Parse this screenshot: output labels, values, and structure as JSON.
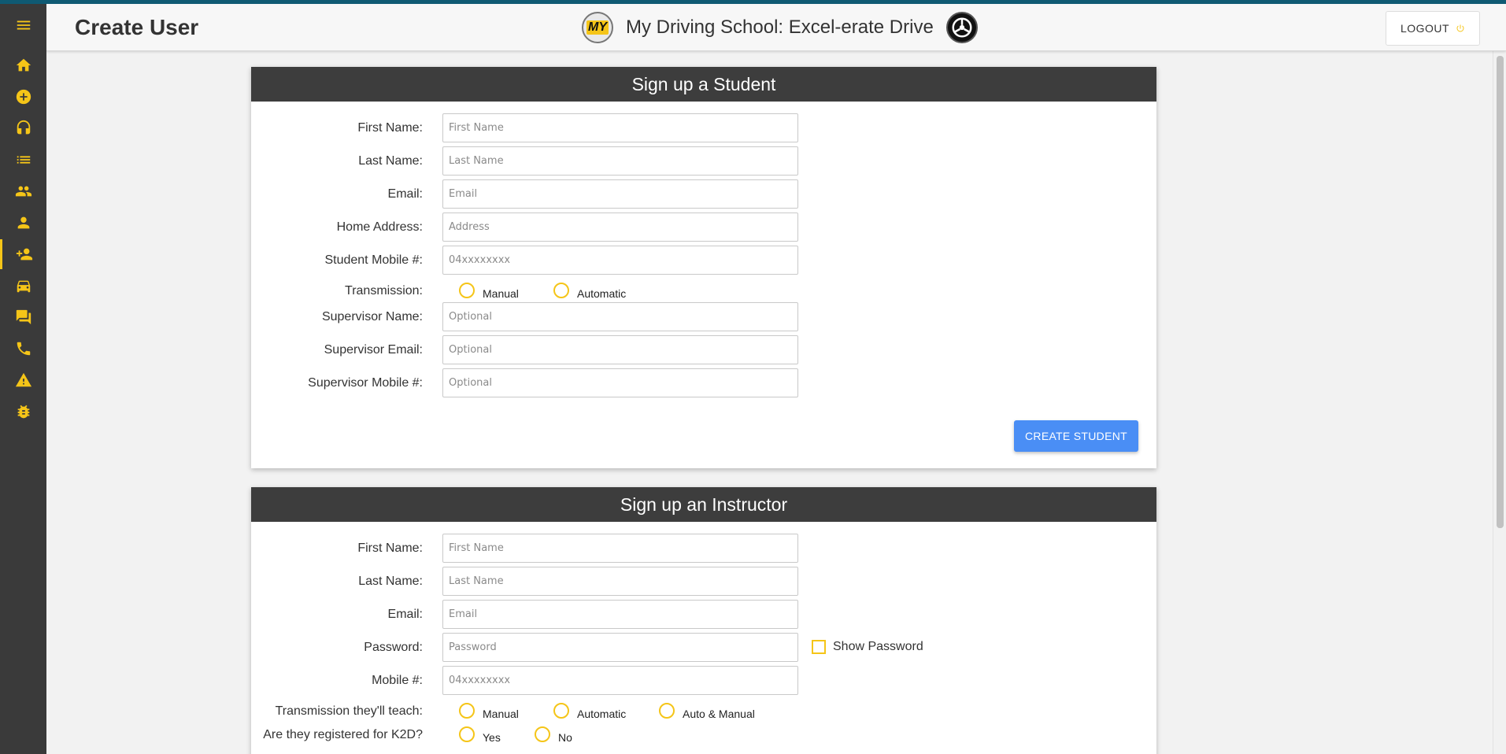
{
  "header": {
    "page_title": "Create User",
    "brand_name": "My Driving School: Excel-erate Drive",
    "logo_left_text": "MY",
    "logout_label": "LOGOUT"
  },
  "sidebar": {
    "items": [
      {
        "name": "home",
        "icon": "home-icon"
      },
      {
        "name": "add",
        "icon": "add-circle-icon"
      },
      {
        "name": "support",
        "icon": "headset-icon"
      },
      {
        "name": "list",
        "icon": "list-icon"
      },
      {
        "name": "users",
        "icon": "people-icon"
      },
      {
        "name": "user",
        "icon": "person-icon"
      },
      {
        "name": "create-user",
        "icon": "person-add-icon",
        "active": true
      },
      {
        "name": "cars",
        "icon": "car-icon"
      },
      {
        "name": "messages",
        "icon": "chat-icon"
      },
      {
        "name": "phone",
        "icon": "phone-icon"
      },
      {
        "name": "alerts",
        "icon": "warning-icon"
      },
      {
        "name": "bugs",
        "icon": "bug-icon"
      }
    ],
    "accent_color": "#f5c518"
  },
  "student": {
    "title": "Sign up a Student",
    "fields": {
      "first_name": {
        "label": "First Name:",
        "placeholder": "First Name",
        "value": ""
      },
      "last_name": {
        "label": "Last Name:",
        "placeholder": "Last Name",
        "value": ""
      },
      "email": {
        "label": "Email:",
        "placeholder": "Email",
        "value": ""
      },
      "address": {
        "label": "Home Address:",
        "placeholder": "Address",
        "value": ""
      },
      "mobile": {
        "label": "Student Mobile #:",
        "placeholder": "04xxxxxxxx",
        "value": ""
      },
      "supervisor_name": {
        "label": "Supervisor Name:",
        "placeholder": "Optional",
        "value": ""
      },
      "supervisor_email": {
        "label": "Supervisor Email:",
        "placeholder": "Optional",
        "value": ""
      },
      "supervisor_mobile": {
        "label": "Supervisor Mobile #:",
        "placeholder": "Optional",
        "value": ""
      }
    },
    "transmission": {
      "label": "Transmission:",
      "options": [
        "Manual",
        "Automatic"
      ]
    },
    "submit_label": "CREATE STUDENT"
  },
  "instructor": {
    "title": "Sign up an Instructor",
    "fields": {
      "first_name": {
        "label": "First Name:",
        "placeholder": "First Name",
        "value": ""
      },
      "last_name": {
        "label": "Last Name:",
        "placeholder": "Last Name",
        "value": ""
      },
      "email": {
        "label": "Email:",
        "placeholder": "Email",
        "value": ""
      },
      "password": {
        "label": "Password:",
        "placeholder": "Password",
        "value": ""
      },
      "mobile": {
        "label": "Mobile #:",
        "placeholder": "04xxxxxxxx",
        "value": ""
      }
    },
    "show_password_label": "Show Password",
    "transmission": {
      "label": "Transmission they'll teach:",
      "options": [
        "Manual",
        "Automatic",
        "Auto & Manual"
      ]
    },
    "k2d": {
      "label": "Are they registered for K2D?",
      "options": [
        "Yes",
        "No"
      ]
    }
  },
  "colors": {
    "accent": "#f5c518",
    "sidebar_bg": "#3a3a3a",
    "card_header_bg": "#3d3d3d",
    "primary_button": "#4a8ef5",
    "top_accent": "#0f5a73"
  }
}
